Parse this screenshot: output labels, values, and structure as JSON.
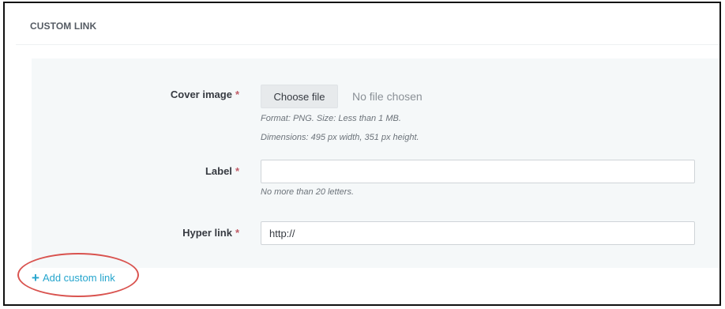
{
  "panel": {
    "title": "CUSTOM LINK"
  },
  "form": {
    "cover_image": {
      "label": "Cover image",
      "required_mark": "*",
      "button_label": "Choose file",
      "file_status": "No file chosen",
      "help_format": "Format: PNG. Size: Less than 1 MB.",
      "help_dimensions": "Dimensions: 495 px width, 351 px height."
    },
    "label_field": {
      "label": "Label",
      "required_mark": "*",
      "value": "",
      "help": "No more than 20 letters."
    },
    "hyper_link": {
      "label": "Hyper link",
      "required_mark": "*",
      "value": "http://"
    }
  },
  "actions": {
    "add_icon": "plus-icon",
    "add_glyph": "+",
    "add_label": "Add custom link"
  },
  "colors": {
    "accent": "#25a5cd",
    "required": "#c05c67",
    "annotation": "#d9534f",
    "form_background": "#f5f8f9"
  }
}
